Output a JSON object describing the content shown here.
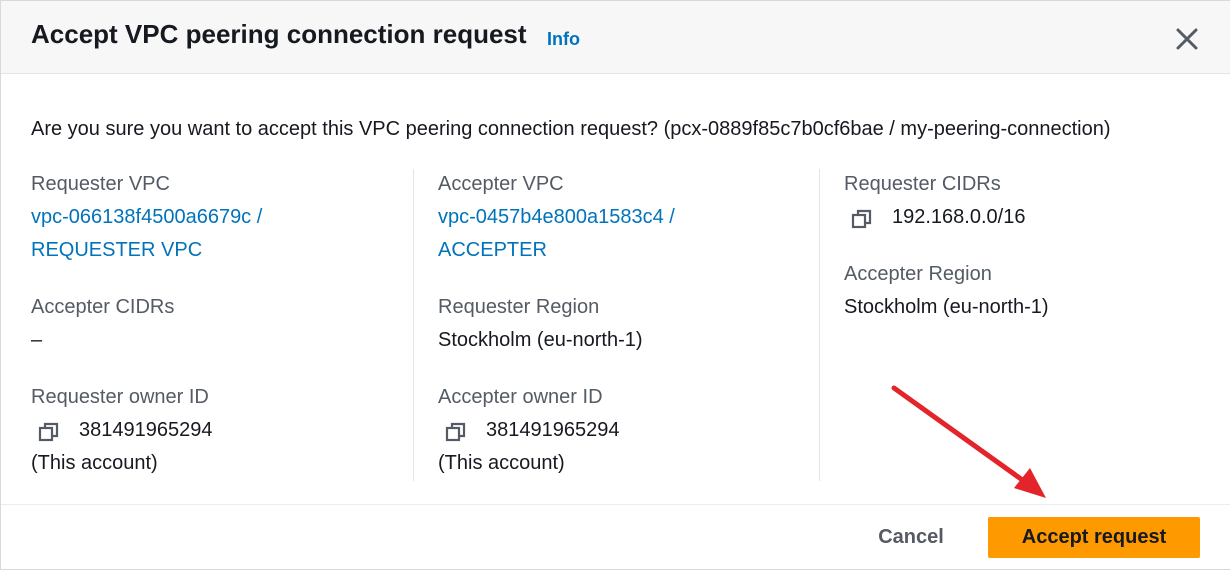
{
  "modal": {
    "title": "Accept VPC peering connection request",
    "info_link": "Info",
    "question": "Are you sure you want to accept this VPC peering connection request? (pcx-0889f85c7b0cf6bae / my-peering-connection)"
  },
  "details": {
    "requester_vpc": {
      "label": "Requester VPC",
      "line1": "vpc-066138f4500a6679c /",
      "line2": "REQUESTER VPC"
    },
    "accepter_cidrs": {
      "label": "Accepter CIDRs",
      "value": "–"
    },
    "requester_owner": {
      "label": "Requester owner ID",
      "id": "381491965294",
      "note": "(This account)"
    },
    "accepter_vpc": {
      "label": "Accepter VPC",
      "line1": "vpc-0457b4e800a1583c4 /",
      "line2": "ACCEPTER"
    },
    "requester_region": {
      "label": "Requester Region",
      "value": "Stockholm (eu-north-1)"
    },
    "accepter_owner": {
      "label": "Accepter owner ID",
      "id": "381491965294",
      "note": "(This account)"
    },
    "requester_cidrs": {
      "label": "Requester CIDRs",
      "value": "192.168.0.0/16"
    },
    "accepter_region": {
      "label": "Accepter Region",
      "value": "Stockholm (eu-north-1)"
    }
  },
  "footer": {
    "cancel_label": "Cancel",
    "accept_label": "Accept request"
  },
  "colors": {
    "link": "#0073bb",
    "primary_button": "#ff9900",
    "annotation_arrow": "#e3242b"
  },
  "icons": [
    "close-icon",
    "copy-icon"
  ]
}
